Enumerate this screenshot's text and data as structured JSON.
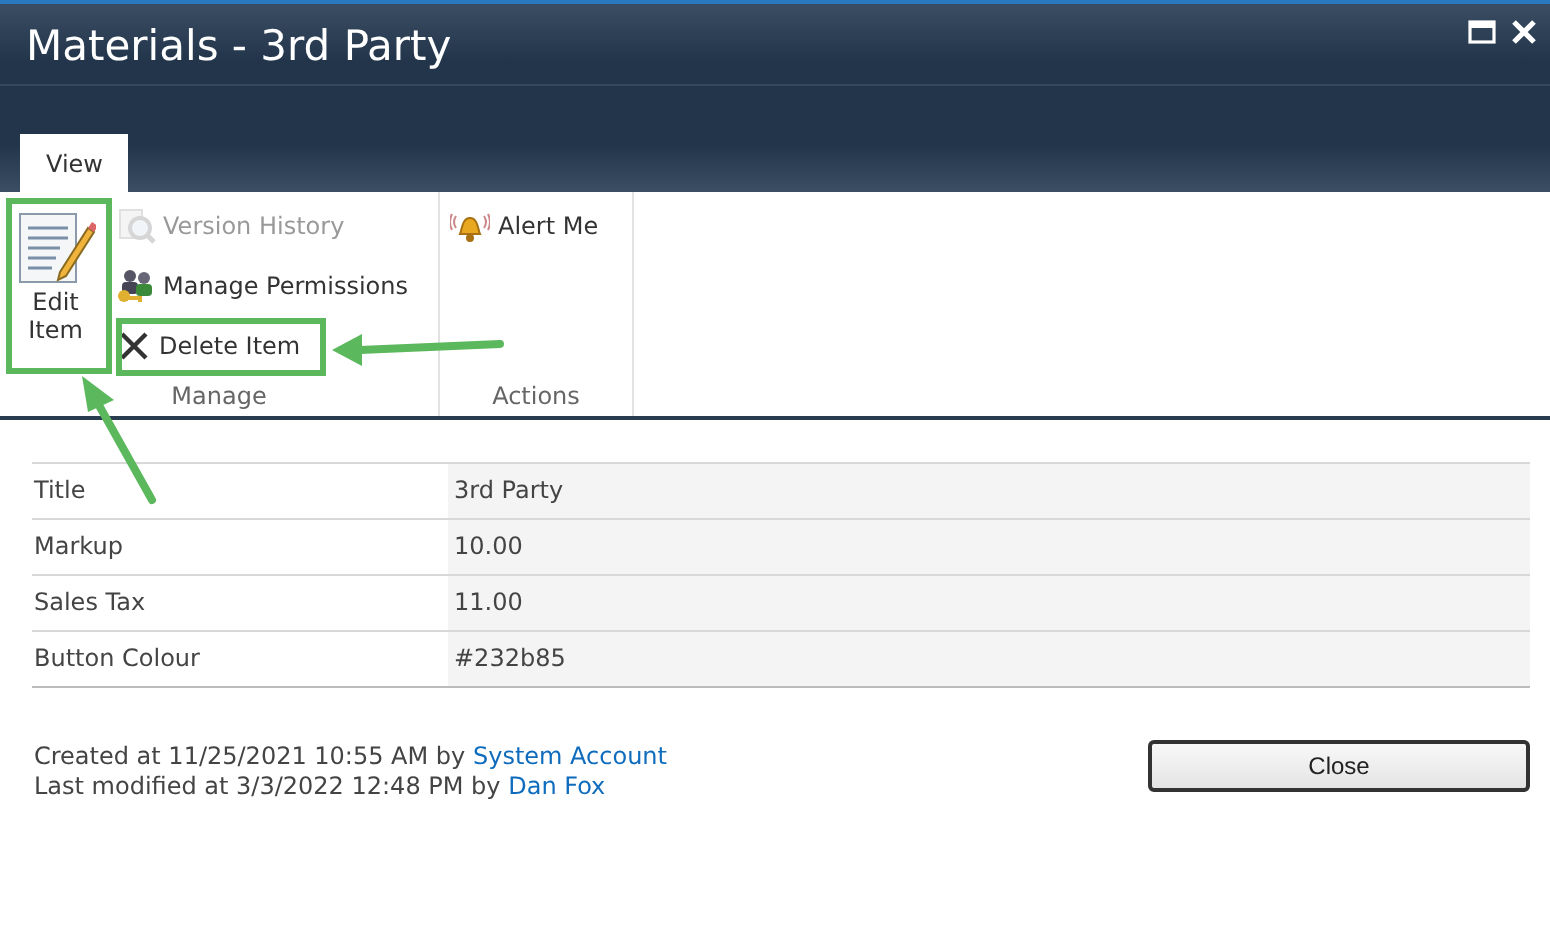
{
  "window": {
    "title": "Materials - 3rd Party"
  },
  "tabs": [
    {
      "label": "View",
      "selected": true
    }
  ],
  "ribbon": {
    "groups": [
      {
        "label": "Manage",
        "items": [
          {
            "kind": "large",
            "label": "Edit\nItem",
            "disabled": false
          },
          {
            "kind": "small",
            "label": "Version History",
            "disabled": true
          },
          {
            "kind": "small",
            "label": "Manage Permissions",
            "disabled": false
          },
          {
            "kind": "small",
            "label": "Delete Item",
            "disabled": false
          }
        ]
      },
      {
        "label": "Actions",
        "items": [
          {
            "kind": "small",
            "label": "Alert Me",
            "disabled": false
          }
        ]
      }
    ]
  },
  "fields": [
    {
      "label": "Title",
      "value": "3rd Party"
    },
    {
      "label": "Markup",
      "value": "10.00"
    },
    {
      "label": "Sales Tax",
      "value": "11.00"
    },
    {
      "label": "Button Colour",
      "value": "#232b85"
    }
  ],
  "footer": {
    "lines": [
      {
        "text": "Created at 11/25/2021 10:55 AM by",
        "link": "System Account"
      },
      {
        "text": "Last modified at 3/3/2022 12:48 PM by",
        "link": "Dan Fox"
      }
    ],
    "button": "Close"
  }
}
